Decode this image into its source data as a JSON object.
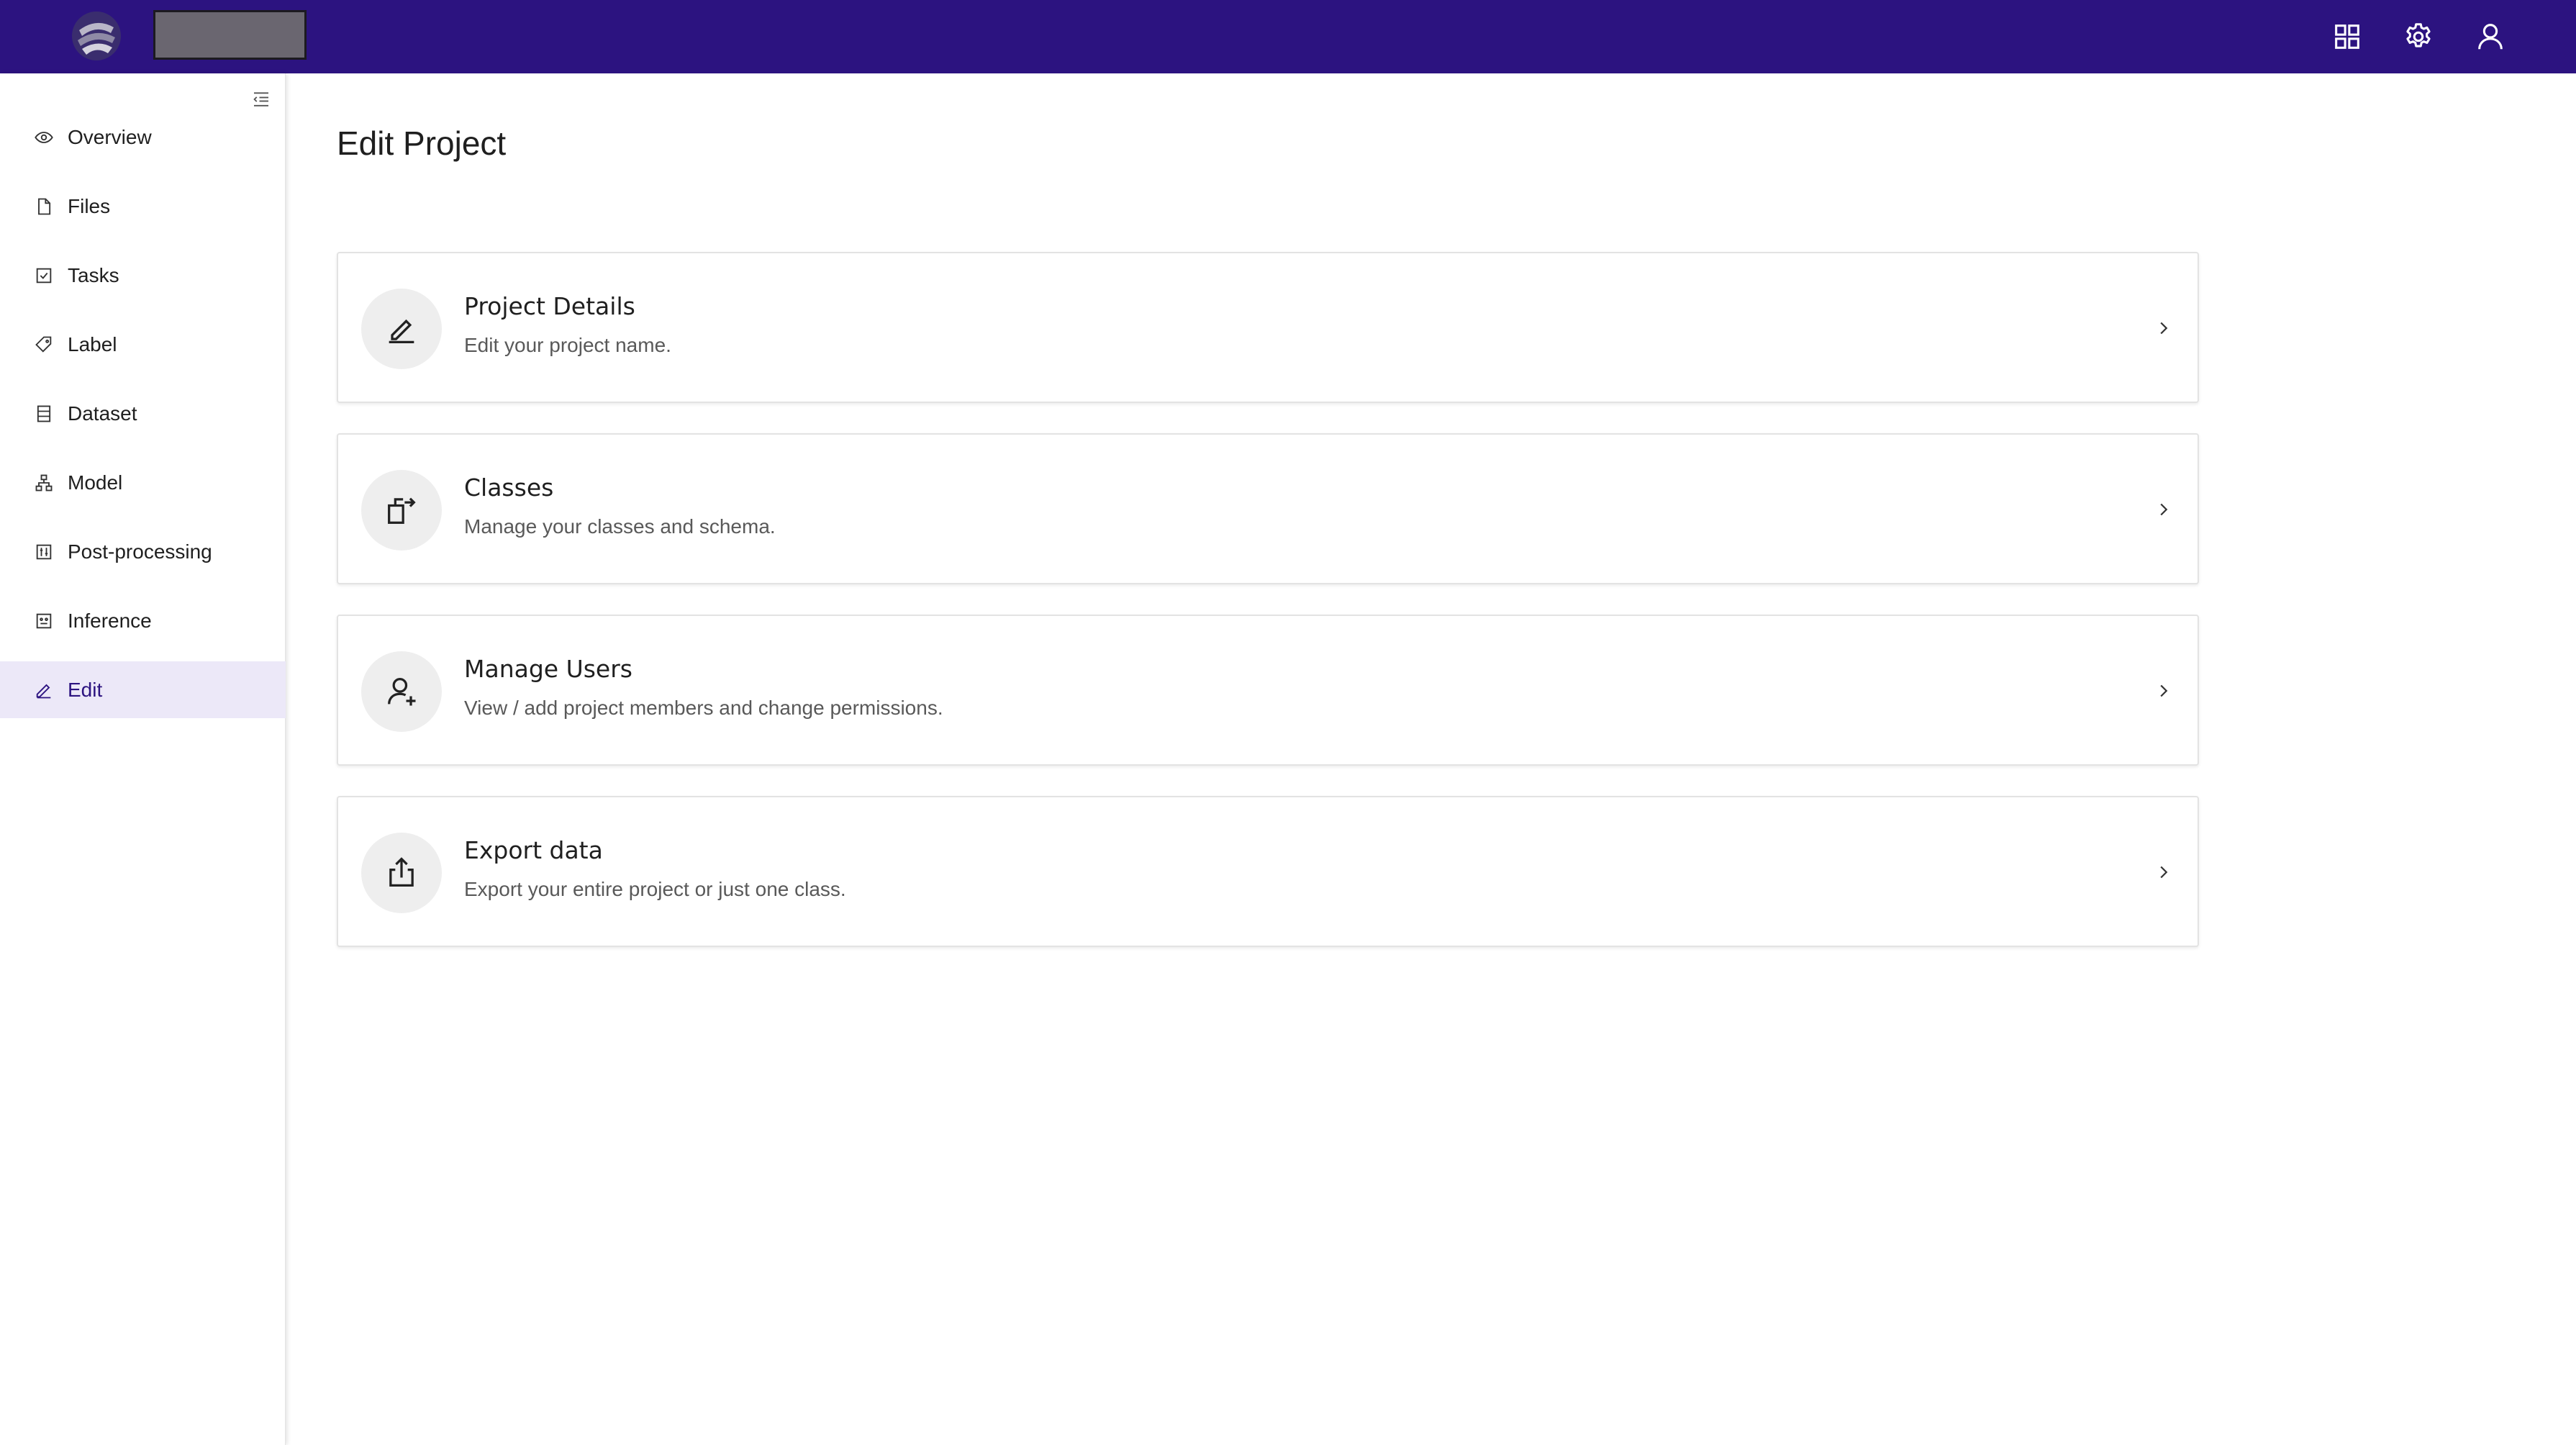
{
  "colors": {
    "topbar": "#2c1380",
    "active_nav_bg": "#ece8f8",
    "card_icon_bg": "#eeeeee"
  },
  "topbar": {
    "icons": [
      "apps-grid-icon",
      "gear-icon",
      "user-icon"
    ]
  },
  "sidebar": {
    "items": [
      {
        "label": "Overview",
        "icon": "eye-icon"
      },
      {
        "label": "Files",
        "icon": "file-icon"
      },
      {
        "label": "Tasks",
        "icon": "checkbox-icon"
      },
      {
        "label": "Label",
        "icon": "tag-icon"
      },
      {
        "label": "Dataset",
        "icon": "database-icon"
      },
      {
        "label": "Model",
        "icon": "hierarchy-icon"
      },
      {
        "label": "Post-processing",
        "icon": "sliders-icon"
      },
      {
        "label": "Inference",
        "icon": "robot-icon"
      },
      {
        "label": "Edit",
        "icon": "pencil-icon",
        "active": true
      }
    ]
  },
  "main": {
    "title": "Edit Project",
    "cards": [
      {
        "title": "Project Details",
        "description": "Edit your project name.",
        "icon": "pencil-icon"
      },
      {
        "title": "Classes",
        "description": "Manage your classes and schema.",
        "icon": "copy-arrow-icon"
      },
      {
        "title": "Manage Users",
        "description": "View / add project members and change permissions.",
        "icon": "add-user-icon"
      },
      {
        "title": "Export data",
        "description": "Export your entire project or just one class.",
        "icon": "export-icon"
      }
    ]
  }
}
